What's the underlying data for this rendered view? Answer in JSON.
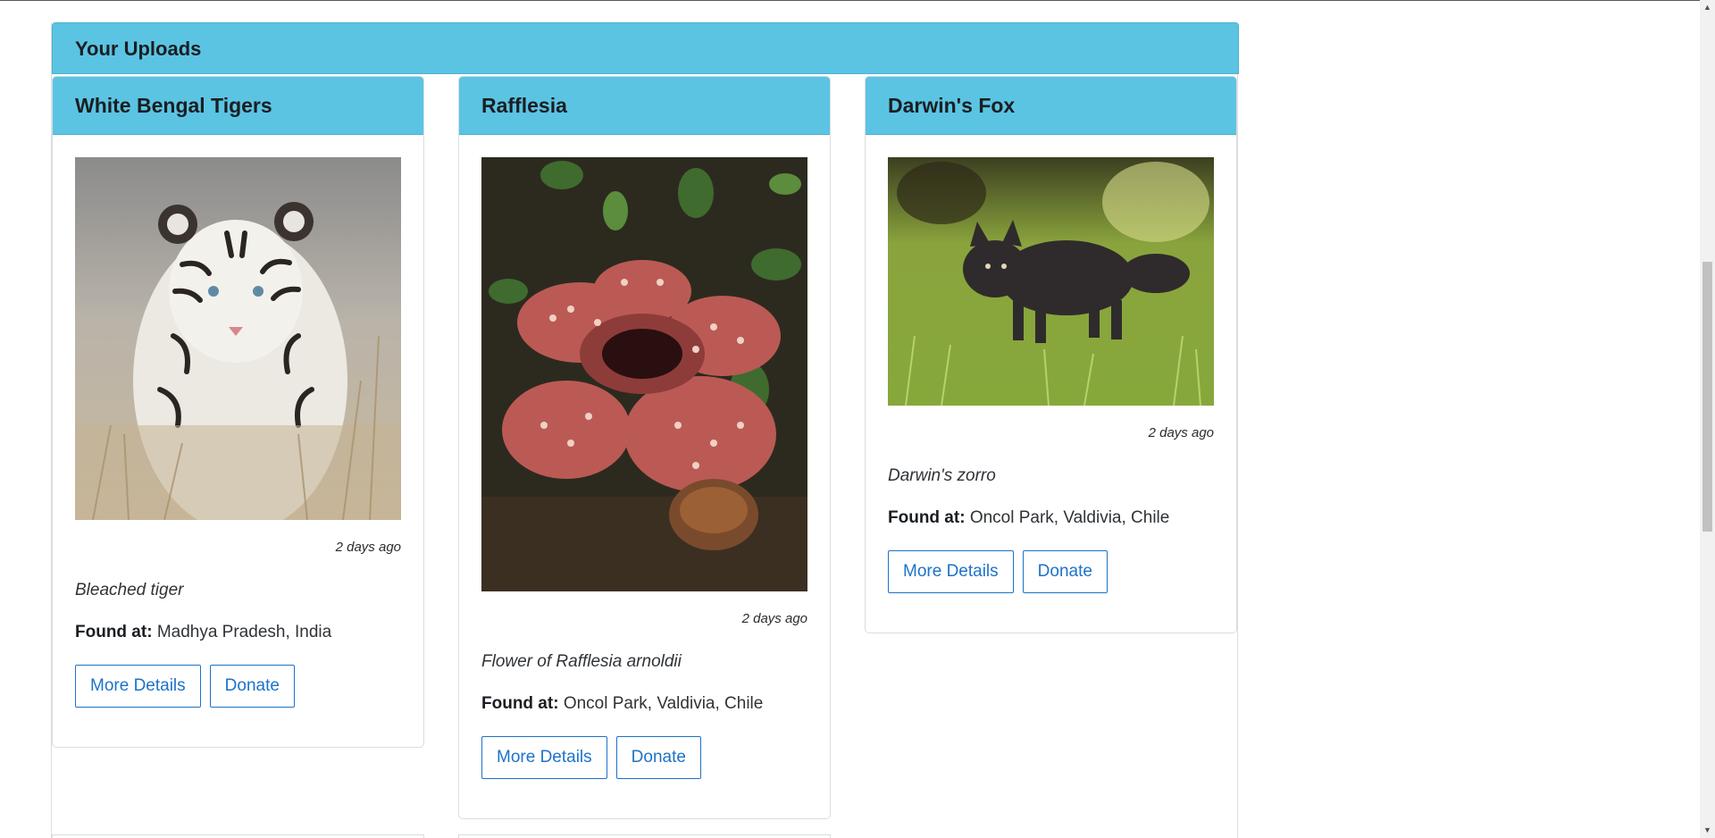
{
  "section": {
    "title": "Your Uploads"
  },
  "cards": [
    {
      "title": "White Bengal Tigers",
      "image": "white-bengal-tiger-photo",
      "date": "2 days ago",
      "common_name": "Bleached tiger",
      "found_label": "Found at:",
      "location": "Madhya Pradesh, India",
      "details_label": "More Details",
      "donate_label": "Donate"
    },
    {
      "title": "Rafflesia",
      "image": "rafflesia-flower-photo",
      "date": "2 days ago",
      "common_name": "Flower of Rafflesia arnoldii",
      "found_label": "Found at:",
      "location": "Oncol Park, Valdivia, Chile",
      "details_label": "More Details",
      "donate_label": "Donate"
    },
    {
      "title": "Darwin's Fox",
      "image": "darwins-fox-photo",
      "date": "2 days ago",
      "common_name": "Darwin's zorro",
      "found_label": "Found at:",
      "location": "Oncol Park, Valdivia, Chile",
      "details_label": "More Details",
      "donate_label": "Donate"
    }
  ],
  "colors": {
    "header_bg": "#5bc4e3",
    "button_accent": "#1d72c9"
  }
}
